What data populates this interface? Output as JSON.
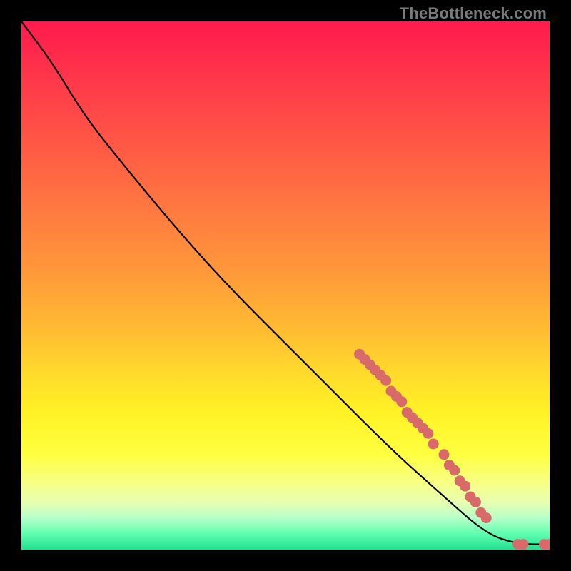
{
  "watermark": "TheBottleneck.com",
  "chart_data": {
    "type": "line",
    "title": "",
    "xlabel": "",
    "ylabel": "",
    "xlim": [
      0,
      100
    ],
    "ylim": [
      0,
      100
    ],
    "curve": [
      {
        "x": 0,
        "y": 100
      },
      {
        "x": 6,
        "y": 92
      },
      {
        "x": 12,
        "y": 82
      },
      {
        "x": 20,
        "y": 72
      },
      {
        "x": 30,
        "y": 60
      },
      {
        "x": 40,
        "y": 49
      },
      {
        "x": 50,
        "y": 39
      },
      {
        "x": 60,
        "y": 29
      },
      {
        "x": 70,
        "y": 19
      },
      {
        "x": 80,
        "y": 10
      },
      {
        "x": 88,
        "y": 3
      },
      {
        "x": 94,
        "y": 1
      },
      {
        "x": 100,
        "y": 1
      }
    ],
    "points": [
      {
        "x": 64,
        "y": 37
      },
      {
        "x": 65,
        "y": 36
      },
      {
        "x": 66,
        "y": 35
      },
      {
        "x": 67,
        "y": 34
      },
      {
        "x": 68,
        "y": 33
      },
      {
        "x": 69,
        "y": 32
      },
      {
        "x": 70,
        "y": 30
      },
      {
        "x": 71,
        "y": 29
      },
      {
        "x": 72,
        "y": 28
      },
      {
        "x": 73,
        "y": 26
      },
      {
        "x": 74,
        "y": 25
      },
      {
        "x": 75,
        "y": 24
      },
      {
        "x": 76,
        "y": 23
      },
      {
        "x": 77,
        "y": 22
      },
      {
        "x": 78,
        "y": 20
      },
      {
        "x": 80,
        "y": 18
      },
      {
        "x": 81,
        "y": 16
      },
      {
        "x": 82,
        "y": 15
      },
      {
        "x": 83,
        "y": 13
      },
      {
        "x": 84,
        "y": 12
      },
      {
        "x": 85,
        "y": 10
      },
      {
        "x": 86,
        "y": 9
      },
      {
        "x": 87,
        "y": 7
      },
      {
        "x": 88,
        "y": 6
      },
      {
        "x": 94,
        "y": 1
      },
      {
        "x": 95,
        "y": 1
      },
      {
        "x": 99,
        "y": 1
      },
      {
        "x": 100,
        "y": 1
      }
    ]
  }
}
